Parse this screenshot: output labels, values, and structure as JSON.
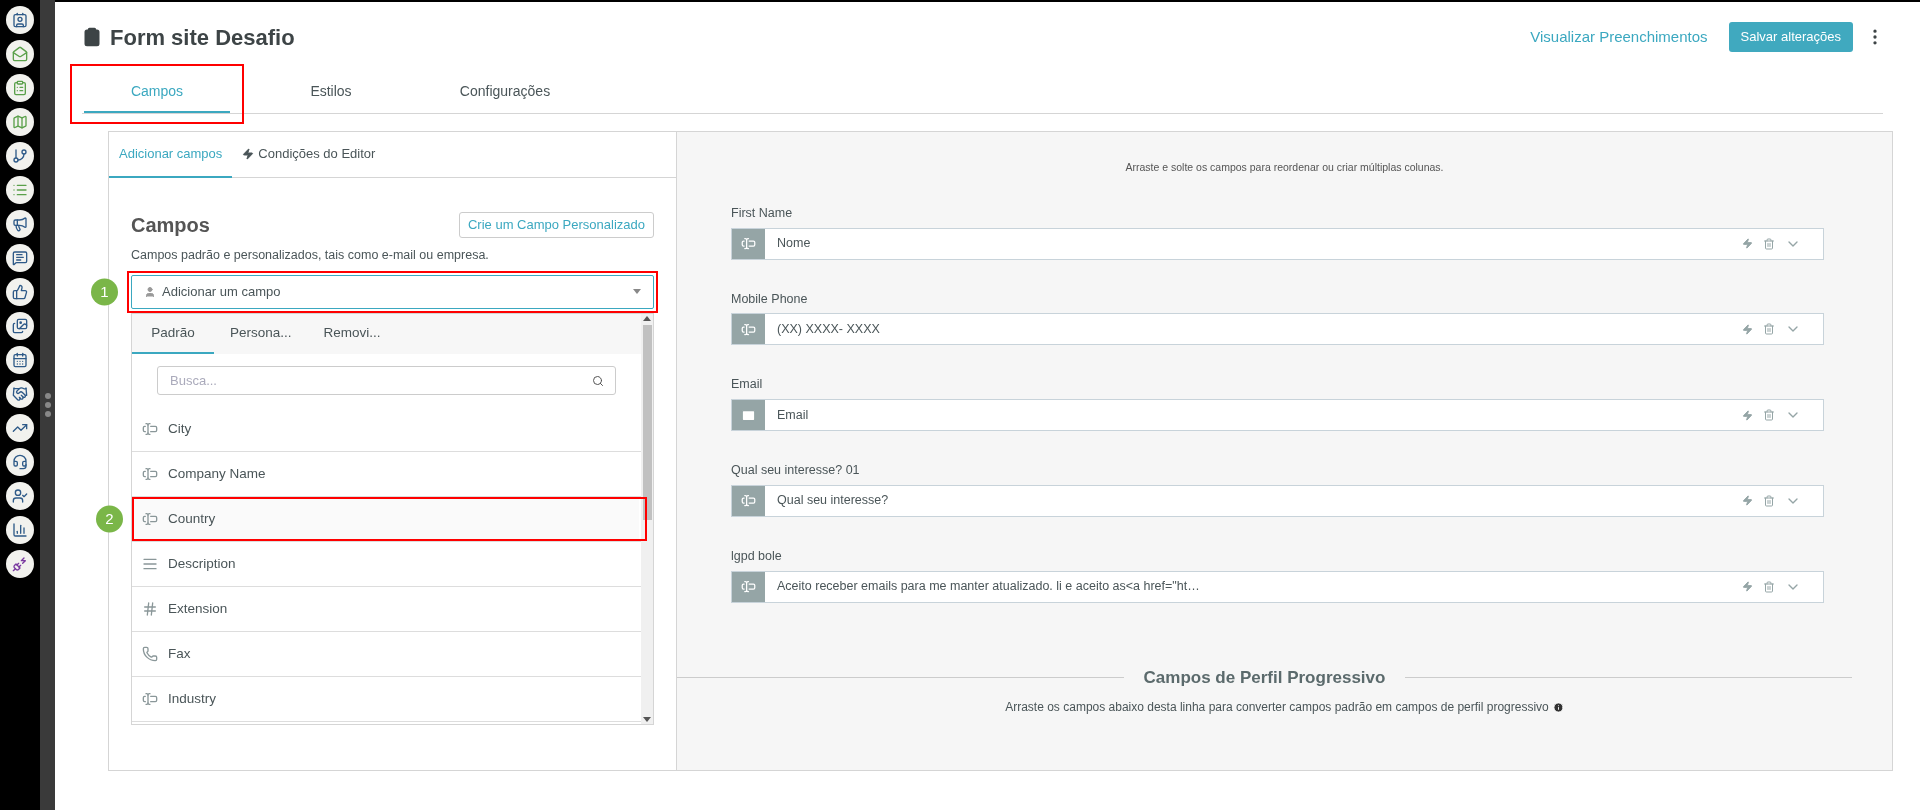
{
  "title": "Form site Desafio",
  "header_actions": {
    "link": "Visualizar Preenchimentos",
    "button": "Salvar alterações"
  },
  "tabs": [
    {
      "label": "Campos",
      "selected": true,
      "highlighted": true
    },
    {
      "label": "Estilos",
      "selected": false,
      "highlighted": false
    },
    {
      "label": "Configurações",
      "selected": false,
      "highlighted": false
    }
  ],
  "left_panel": {
    "tabs": [
      {
        "label": "Adicionar campos",
        "selected": true,
        "kind": "plain"
      },
      {
        "label": "Condições do Editor",
        "selected": false,
        "kind": "bolt"
      }
    ],
    "heading": "Campos",
    "create_button": "Crie um Campo Personalizado",
    "description": "Campos padrão e personalizados, tais como e-mail ou empresa.",
    "field_select": {
      "placeholder": "Adicionar um campo",
      "highlighted": true,
      "marker": "1"
    },
    "dropdown": {
      "tabs": [
        {
          "label": "Padrão",
          "selected": true
        },
        {
          "label": "Persona...",
          "selected": false
        },
        {
          "label": "Removi...",
          "selected": false
        }
      ],
      "search": {
        "placeholder": "Busca..."
      },
      "items": [
        {
          "label": "City",
          "kind": "text",
          "highlighted": false
        },
        {
          "label": "Company Name",
          "kind": "text",
          "highlighted": false
        },
        {
          "label": "Country",
          "kind": "text",
          "highlighted": true,
          "marker": "2"
        },
        {
          "label": "Description",
          "kind": "textarea",
          "highlighted": false
        },
        {
          "label": "Extension",
          "kind": "number",
          "highlighted": false
        },
        {
          "label": "Fax",
          "kind": "phone",
          "highlighted": false
        },
        {
          "label": "Industry",
          "kind": "text",
          "highlighted": false
        }
      ]
    }
  },
  "canvas": {
    "hint": "Arraste e solte os campos para reordenar ou criar múltiplas colunas.",
    "fields": [
      {
        "label": "First Name",
        "kind": "text",
        "placeholder": "Nome"
      },
      {
        "label": "Mobile Phone",
        "kind": "text",
        "placeholder": "(XX) XXXX- XXXX"
      },
      {
        "label": "Email",
        "kind": "email",
        "placeholder": "Email"
      },
      {
        "label": "Qual seu interesse? 01",
        "kind": "text",
        "placeholder": "Qual seu interesse?"
      },
      {
        "label": "lgpd bole",
        "kind": "text",
        "placeholder": "Aceito receber emails para me manter atualizado. li e aceito as<a href=\"ht…"
      }
    ],
    "progressive": {
      "title": "Campos de Perfil Progressivo",
      "description": "Arraste os campos abaixo desta linha para converter campos padrão em campos de perfil progressivo"
    }
  }
}
